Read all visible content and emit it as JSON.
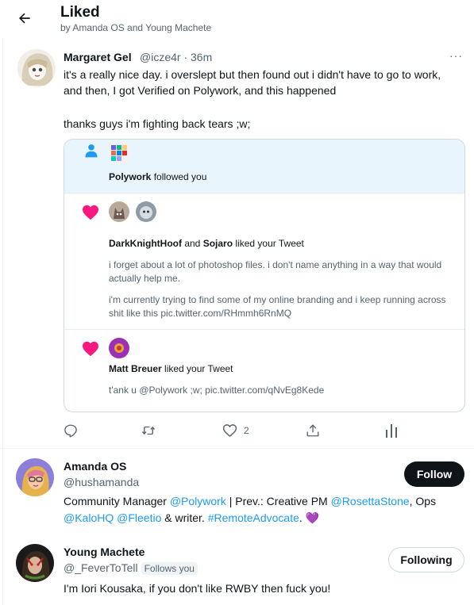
{
  "header": {
    "title": "Liked",
    "subtitle": "by Amanda OS and Young Machete",
    "back_icon": "arrow-left-icon"
  },
  "tweet": {
    "author_name": "Margaret Gel",
    "author_handle_time": "@icze4r · 36m",
    "more": "···",
    "text_line1": "it's a really nice day. i overslept but then found out i didn't have to go to work, and then, I got Verified on Polywork, and this happened",
    "text_line2": "thanks guys i'm fighting back tears ;w;",
    "media": {
      "notif1": {
        "actor": "Polywork",
        "action": " followed you",
        "icon": "person-icon"
      },
      "notif2": {
        "actor1": "DarkKnightHoof",
        "joiner": " and ",
        "actor2": "Sojaro",
        "action": " liked your Tweet",
        "body1": "i forget about a lot of photoshop files. i don't name anything in a way that would actually help me.",
        "body2": " i'm currently trying to find some of my online branding and i keep running across shit like this pic.twitter.com/RHmmh6RnMQ",
        "icon": "heart-icon"
      },
      "notif3": {
        "actor": "Matt Breuer",
        "action": " liked your Tweet",
        "body": "t'ank u @Polywork ;w; pic.twitter.com/qNvEg8Kede",
        "icon": "heart-icon"
      }
    },
    "actions": {
      "reply_icon": "reply-icon",
      "retweet_icon": "retweet-icon",
      "like_icon": "like-icon",
      "like_count": "2",
      "share_icon": "share-icon",
      "analytics_icon": "analytics-icon"
    }
  },
  "users": [
    {
      "name": "Amanda OS",
      "handle": "@hushamanda",
      "button": "Follow",
      "bio": {
        "p1": "Community Manager ",
        "l1": "@Polywork",
        "p2": " | Prev.: Creative PM ",
        "l2": "@RosettaStone",
        "p3": ", Ops ",
        "l3": "@KaloHQ",
        "p4": " ",
        "l4": "@Fleetio",
        "p5": " & writer. ",
        "l5": "#RemoteAdvocate",
        "p6": ". 💜"
      }
    },
    {
      "name": "Young Machete",
      "handle": "@_FeverToTell",
      "follows_you": "Follows you",
      "button": "Following",
      "bio": "I'm Iori Kousaka, if you don't like RWBY then fuck you!"
    }
  ],
  "colors": {
    "accent": "#1d9bf0",
    "heart": "#f91880",
    "text": "#0f1419",
    "muted": "#536471",
    "notif_bg": "#e8f5fd"
  }
}
